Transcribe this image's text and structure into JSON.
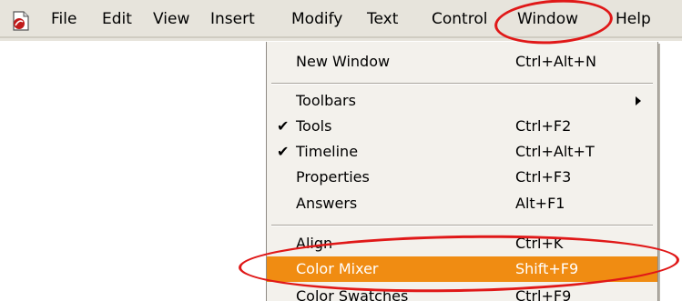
{
  "menubar": {
    "app_icon": "flash-app-icon",
    "items": [
      {
        "label": "File"
      },
      {
        "label": "Edit"
      },
      {
        "label": "View"
      },
      {
        "label": "Insert"
      },
      {
        "label": "Modify"
      },
      {
        "label": "Text"
      },
      {
        "label": "Control"
      },
      {
        "label": "Window"
      },
      {
        "label": "Help"
      }
    ]
  },
  "window_menu": {
    "items": [
      {
        "label": "New Window",
        "shortcut": "Ctrl+Alt+N"
      },
      {
        "label": "Toolbars",
        "shortcut": "",
        "submenu": true
      },
      {
        "label": "Tools",
        "shortcut": "Ctrl+F2",
        "checked": true
      },
      {
        "label": "Timeline",
        "shortcut": "Ctrl+Alt+T",
        "checked": true
      },
      {
        "label": "Properties",
        "shortcut": "Ctrl+F3"
      },
      {
        "label": "Answers",
        "shortcut": "Alt+F1"
      },
      {
        "label": "Align",
        "shortcut": "Ctrl+K"
      },
      {
        "label": "Color Mixer",
        "shortcut": "Shift+F9",
        "highlighted": true
      },
      {
        "label": "Color Swatches",
        "shortcut": "Ctrl+F9"
      }
    ]
  },
  "colors": {
    "highlight": "#f08c12",
    "annotation": "#e01818"
  }
}
